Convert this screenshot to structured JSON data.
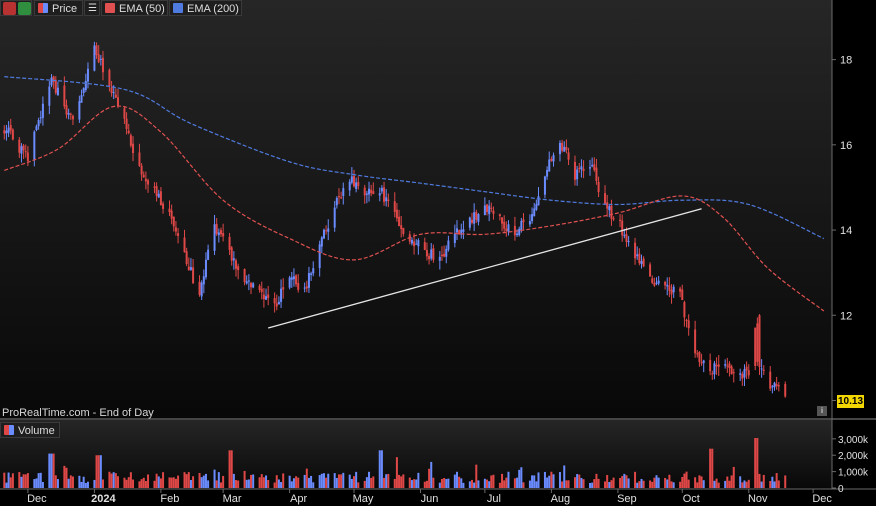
{
  "toolbar": {
    "price_label": "Price",
    "ema50_label": "EMA (50)",
    "ema200_label": "EMA (200)",
    "volume_label": "Volume"
  },
  "watermark": "ProRealTime.com - End of Day",
  "last_price": "10.13",
  "info_icon": "i",
  "colors": {
    "up": "#6b8cff",
    "down": "#e04848",
    "ema50": "#e05050",
    "ema200": "#4f7be0",
    "trendline": "#e6e6e6",
    "background": "#000000",
    "axis_text": "#e0e0e0",
    "price_tag": "#f2d600"
  },
  "chart_data": [
    {
      "type": "candlestick",
      "title": "",
      "x_ticks": [
        "Dec",
        "2024",
        "Feb",
        "Mar",
        "Apr",
        "May",
        "Jun",
        "Jul",
        "Aug",
        "Sep",
        "Oct",
        "Nov",
        "Dec"
      ],
      "y_ticks": [
        10,
        12,
        14,
        16,
        18
      ],
      "ylim": [
        9.8,
        19.0
      ],
      "series": [
        {
          "name": "Price",
          "kind": "close_path",
          "dates": [
            "2023-11-20",
            "2023-12-01",
            "2023-12-12",
            "2023-12-22",
            "2024-01-01",
            "2024-01-08",
            "2024-01-15",
            "2024-01-22",
            "2024-01-29",
            "2024-02-05",
            "2024-02-12",
            "2024-02-19",
            "2024-02-26",
            "2024-03-04",
            "2024-03-11",
            "2024-03-18",
            "2024-03-25",
            "2024-04-01",
            "2024-04-08",
            "2024-04-15",
            "2024-04-22",
            "2024-04-29",
            "2024-05-06",
            "2024-05-13",
            "2024-05-20",
            "2024-05-27",
            "2024-06-03",
            "2024-06-10",
            "2024-06-17",
            "2024-06-24",
            "2024-07-01",
            "2024-07-08",
            "2024-07-15",
            "2024-07-22",
            "2024-07-29",
            "2024-08-05",
            "2024-08-12",
            "2024-08-19",
            "2024-08-26",
            "2024-09-02",
            "2024-09-09",
            "2024-09-16",
            "2024-09-23",
            "2024-09-30",
            "2024-10-07",
            "2024-10-14",
            "2024-10-21",
            "2024-10-28",
            "2024-11-04",
            "2024-11-11",
            "2024-11-18",
            "2024-11-25",
            "2024-12-02",
            "2024-12-06"
          ],
          "close": [
            16.4,
            15.7,
            17.5,
            16.5,
            18.3,
            17.4,
            16.5,
            15.4,
            14.9,
            14.3,
            13.4,
            12.5,
            14.1,
            13.5,
            12.8,
            12.5,
            12.2,
            12.9,
            12.6,
            13.6,
            14.6,
            15.2,
            14.9,
            15.0,
            14.3,
            13.8,
            13.5,
            13.3,
            13.9,
            14.2,
            14.6,
            14.2,
            14.0,
            14.3,
            15.3,
            16.1,
            15.3,
            15.6,
            14.6,
            14.1,
            13.4,
            12.8,
            12.7,
            12.5,
            11.0,
            10.7,
            10.9,
            10.5,
            10.9,
            10.4,
            10.13
          ]
        },
        {
          "name": "EMA (50)",
          "kind": "line",
          "dates": [
            "2023-11-20",
            "2023-12-15",
            "2024-01-10",
            "2024-02-01",
            "2024-03-01",
            "2024-04-01",
            "2024-05-01",
            "2024-06-01",
            "2024-07-01",
            "2024-08-01",
            "2024-09-01",
            "2024-10-01",
            "2024-10-20",
            "2024-11-10",
            "2024-12-06"
          ],
          "values": [
            15.4,
            15.9,
            16.9,
            16.3,
            14.7,
            13.8,
            13.3,
            13.9,
            13.9,
            14.1,
            14.4,
            14.8,
            14.3,
            13.1,
            12.1
          ]
        },
        {
          "name": "EMA (200)",
          "kind": "line",
          "dates": [
            "2023-11-20",
            "2024-01-15",
            "2024-02-15",
            "2024-04-01",
            "2024-05-01",
            "2024-06-01",
            "2024-07-01",
            "2024-08-01",
            "2024-09-01",
            "2024-10-01",
            "2024-11-01",
            "2024-12-06"
          ],
          "values": [
            17.6,
            17.3,
            16.5,
            15.6,
            15.3,
            15.1,
            14.9,
            14.7,
            14.6,
            14.7,
            14.6,
            13.8
          ]
        },
        {
          "name": "trendline",
          "kind": "line",
          "dates": [
            "2024-03-22",
            "2024-10-10"
          ],
          "values": [
            11.7,
            14.5
          ]
        }
      ]
    },
    {
      "type": "bar",
      "title": "Volume",
      "y_ticks": [
        "0",
        "1,000k",
        "2,000k",
        "3,000k"
      ],
      "ylim": [
        0,
        3600
      ],
      "unit": "k",
      "peaks": [
        {
          "date": "2023-12-12",
          "value": 2100
        },
        {
          "date": "2024-01-03",
          "value": 2000
        },
        {
          "date": "2024-03-04",
          "value": 2300
        },
        {
          "date": "2024-05-13",
          "value": 2300
        },
        {
          "date": "2024-10-14",
          "value": 2400
        },
        {
          "date": "2024-11-04",
          "value": 3400
        },
        {
          "date": "2024-11-22",
          "value": 3100
        }
      ]
    }
  ]
}
